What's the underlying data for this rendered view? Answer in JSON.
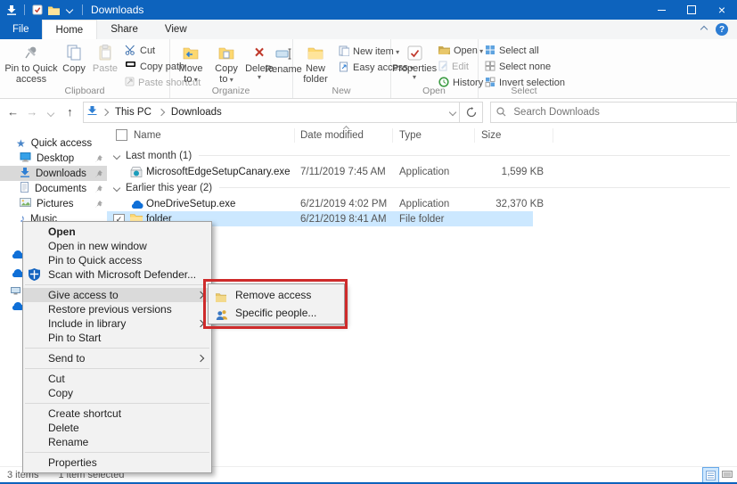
{
  "colors": {
    "accent": "#0d63bd",
    "selection": "#cce8ff",
    "annotation_red": "#ce2b2b"
  },
  "titlebar": {
    "title": "Downloads"
  },
  "tabs": {
    "file": "File",
    "home": "Home",
    "share": "Share",
    "view": "View"
  },
  "ribbon": {
    "clipboard": {
      "label": "Clipboard",
      "pin": "Pin to Quick access",
      "copy": "Copy",
      "paste": "Paste",
      "cut": "Cut",
      "copy_path": "Copy path",
      "paste_shortcut": "Paste shortcut"
    },
    "organize": {
      "label": "Organize",
      "move_to": "Move to",
      "copy_to": "Copy to",
      "delete": "Delete",
      "rename": "Rename"
    },
    "new_group": {
      "label": "New",
      "new_folder": "New folder",
      "new_item": "New item",
      "easy_access": "Easy access"
    },
    "open_group": {
      "label": "Open",
      "properties": "Properties",
      "open": "Open",
      "edit": "Edit",
      "history": "History"
    },
    "select_group": {
      "label": "Select",
      "select_all": "Select all",
      "select_none": "Select none",
      "invert_selection": "Invert selection"
    }
  },
  "address": {
    "root": "This PC",
    "current": "Downloads"
  },
  "search": {
    "placeholder": "Search Downloads"
  },
  "sidebar": {
    "quick_access": "Quick access",
    "desktop": "Desktop",
    "downloads": "Downloads",
    "documents": "Documents",
    "pictures": "Pictures",
    "music": "Music"
  },
  "list": {
    "columns": {
      "name": "Name",
      "date": "Date modified",
      "type": "Type",
      "size": "Size"
    },
    "groups": {
      "g1": "Last month (1)",
      "g2": "Earlier this year (2)"
    },
    "rows": [
      {
        "name": "MicrosoftEdgeSetupCanary.exe",
        "date": "7/11/2019 7:45 AM",
        "type": "Application",
        "size": "1,599 KB"
      },
      {
        "name": "OneDriveSetup.exe",
        "date": "6/21/2019 4:02 PM",
        "type": "Application",
        "size": "32,370 KB"
      },
      {
        "name": "folder",
        "date": "6/21/2019 8:41 AM",
        "type": "File folder",
        "size": ""
      }
    ]
  },
  "context_menu": {
    "items": [
      {
        "label": "Open"
      },
      {
        "label": "Open in new window"
      },
      {
        "label": "Pin to Quick access"
      },
      {
        "label": "Scan with Microsoft Defender..."
      },
      {
        "label": "Give access to"
      },
      {
        "label": "Restore previous versions"
      },
      {
        "label": "Include in library"
      },
      {
        "label": "Pin to Start"
      },
      {
        "label": "Send to"
      },
      {
        "label": "Cut"
      },
      {
        "label": "Copy"
      },
      {
        "label": "Create shortcut"
      },
      {
        "label": "Delete"
      },
      {
        "label": "Rename"
      },
      {
        "label": "Properties"
      }
    ]
  },
  "submenu": {
    "items": [
      {
        "label": "Remove access"
      },
      {
        "label": "Specific people..."
      }
    ]
  },
  "status": {
    "count": "3 items",
    "selected": "1 item selected"
  }
}
